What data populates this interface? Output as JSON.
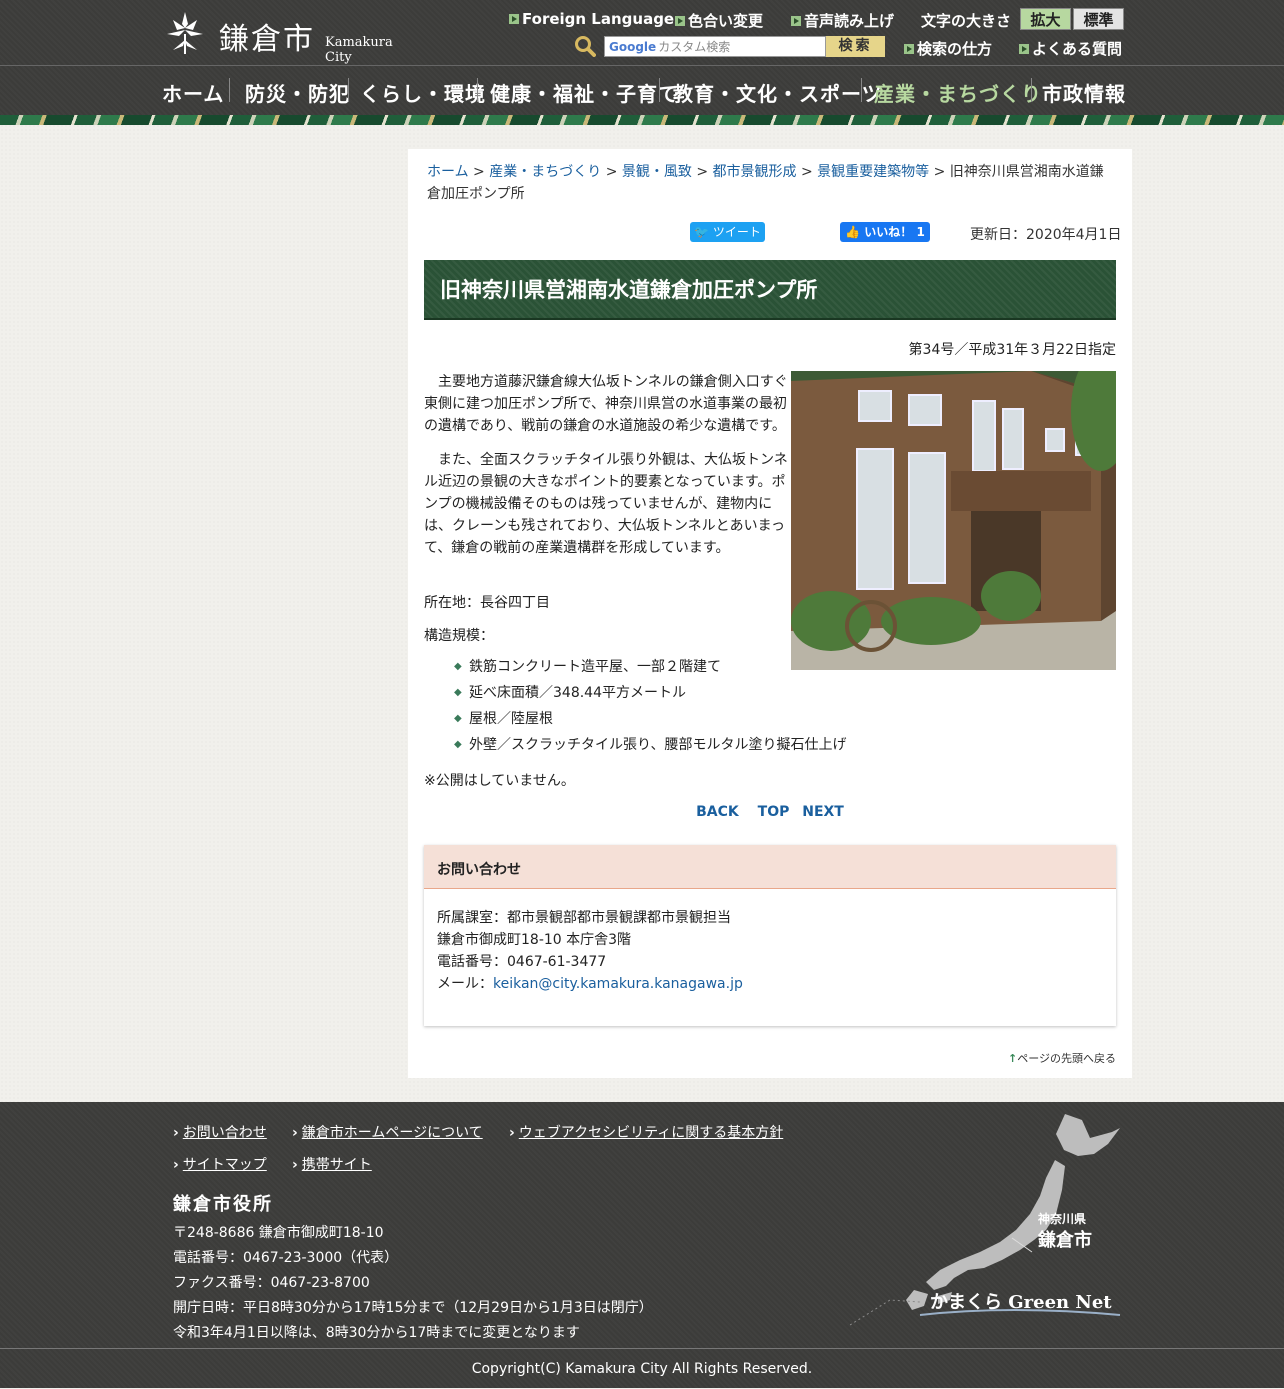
{
  "header": {
    "logo_jp": "鎌倉市",
    "logo_en": "Kamakura City",
    "links": [
      "Foreign Language",
      "色合い変更",
      "音声読み上げ"
    ],
    "font_size_label": "文字の大きさ",
    "font_enlarge": "拡大",
    "font_standard": "標準",
    "search_brand": "Google",
    "search_placeholder": "カスタム検索",
    "search_button": "検索",
    "search_help": "検索の仕方",
    "faq": "よくある質問"
  },
  "nav": {
    "items": [
      "ホーム",
      "防災・防犯",
      "くらし・環境",
      "健康・福祉・子育て",
      "教育・文化・スポーツ",
      "産業・まちづくり",
      "市政情報"
    ],
    "active_index": 5,
    "active_color": "#b7d8a0"
  },
  "breadcrumb": {
    "links": [
      "ホーム",
      "産業・まちづくり",
      "景観・風致",
      "都市景観形成",
      "景観重要建築物等"
    ],
    "current": "旧神奈川県営湘南水道鎌倉加圧ポンプ所",
    "separator": ">"
  },
  "social": {
    "tweet": "ツイート",
    "like": "いいね！ 1"
  },
  "updated": "更新日：2020年4月1日",
  "page": {
    "title": "旧神奈川県営湘南水道鎌倉加圧ポンプ所",
    "designation": "第34号／平成31年３月22日指定",
    "para1": "主要地方道藤沢鎌倉線大仏坂トンネルの鎌倉側入口すぐ東側に建つ加圧ポンプ所で、神奈川県営の水道事業の最初の遺構であり、戦前の鎌倉の水道施設の希少な遺構です。",
    "para2": "また、全面スクラッチタイル張り外観は、大仏坂トンネル近辺の景観の大きなポイント的要素となっています。ポンプの機械設備そのものは残っていませんが、建物内には、クレーンも残されており、大仏坂トンネルとあいまって、鎌倉の戦前の産業遺構群を形成しています。",
    "location": "所在地：長谷四丁目",
    "structure_label": "構造規模：",
    "specs": [
      "鉄筋コンクリート造平屋、一部２階建て",
      "延べ床面積／348.44平方メートル",
      "屋根／陸屋根",
      "外壁／スクラッチタイル張り、腰部モルタル塗り擬石仕上げ"
    ],
    "note": "※公開はしていません。",
    "pager": [
      "BACK",
      "TOP",
      "NEXT"
    ]
  },
  "inquiry": {
    "heading": "お問い合わせ",
    "dept": "所属課室：都市景観部都市景観課都市景観担当",
    "address": "鎌倉市御成町18-10 本庁舎3階",
    "tel": "電話番号：0467-61-3477",
    "mail_label": "メール：",
    "mail": "keikan@city.kamakura.kanagawa.jp"
  },
  "to_top": "ページの先頭へ戻る",
  "footer": {
    "links": [
      "お問い合わせ",
      "鎌倉市ホームページについて",
      "ウェブアクセシビリティに関する基本方針",
      "サイトマップ",
      "携帯サイト"
    ],
    "office": "鎌倉市役所",
    "postal": "〒248-8686 鎌倉市御成町18-10",
    "tel": "電話番号：0467-23-3000（代表）",
    "fax": "ファクス番号：0467-23-8700",
    "hours": "開庁日時：平日8時30分から17時15分まで（12月29日から1月3日は閉庁）",
    "hours_note": "令和3年4月1日以降は、8時30分から17時までに変更となります",
    "map_pref": "神奈川県",
    "map_city": "鎌倉市",
    "greennet": "かまくら Green Net",
    "copyright": "Copyright(C) Kamakura City All Rights Reserved."
  }
}
